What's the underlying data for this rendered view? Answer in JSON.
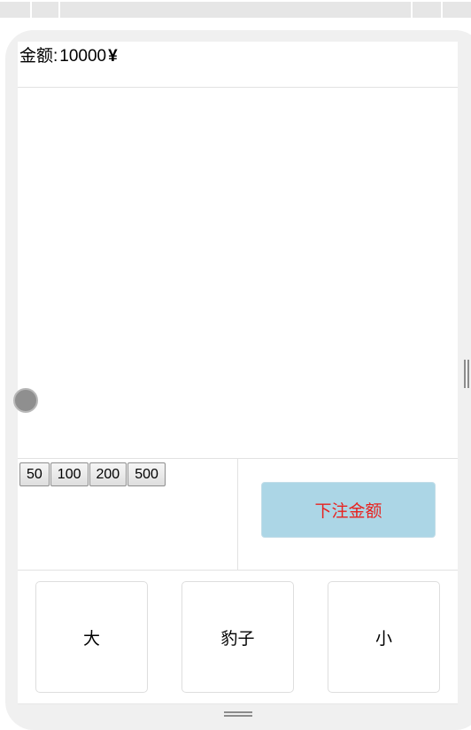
{
  "header": {
    "amount_label": "金额:",
    "amount_value": "10000",
    "currency": "¥"
  },
  "chips": [
    "50",
    "100",
    "200",
    "500"
  ],
  "bet_button": {
    "label": "下注金额",
    "background": "#acd6e6",
    "text_color": "#e8221f"
  },
  "choices": [
    "大",
    "豹子",
    "小"
  ]
}
